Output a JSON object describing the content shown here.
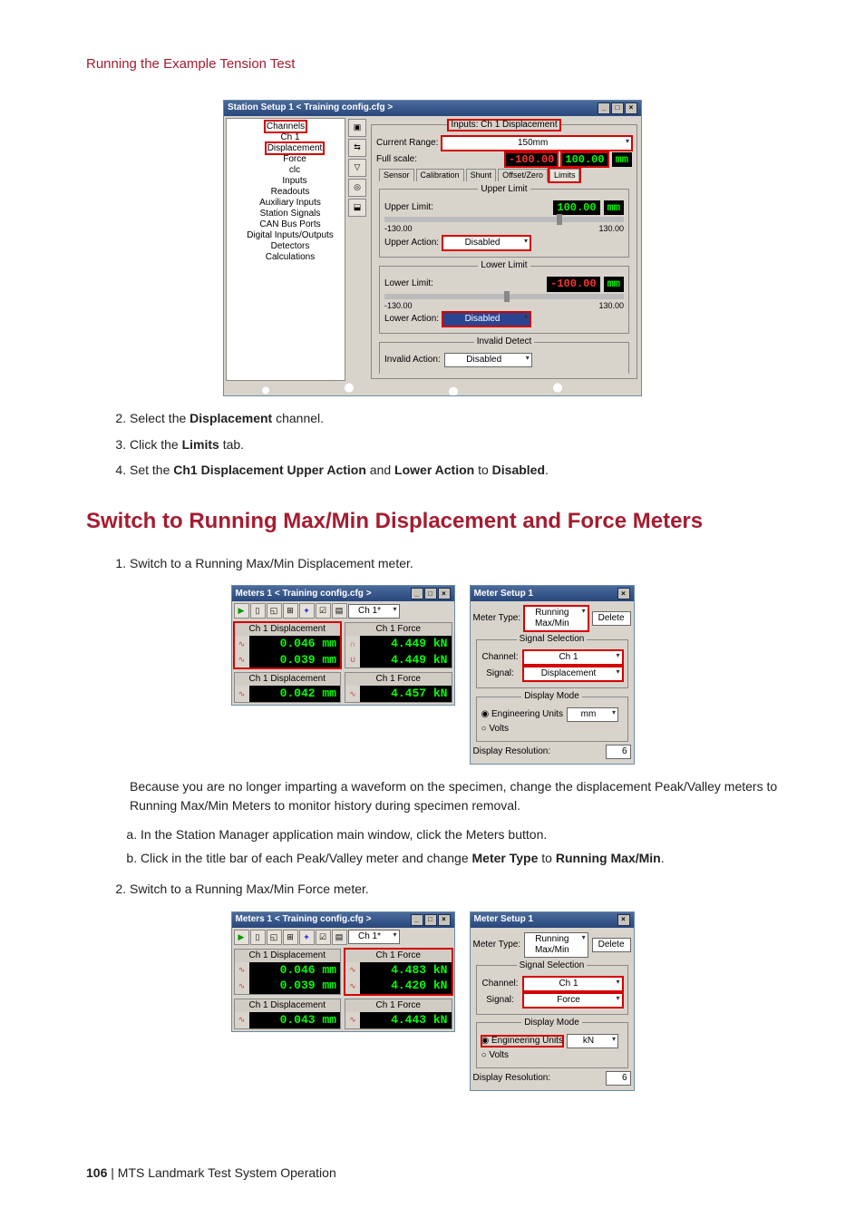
{
  "running_header": "Running the Example Tension Test",
  "steps_a": {
    "s2": {
      "pre": "Select the ",
      "bold": "Displacement",
      "post": " channel."
    },
    "s3": {
      "pre": "Click the ",
      "bold": "Limits",
      "post": " tab."
    },
    "s4": {
      "pre": "Set the ",
      "b1": "Ch1 Displacement Upper Action",
      "mid": " and ",
      "b2": "Lower Action",
      "post2": " to ",
      "b3": "Disabled",
      "end": "."
    }
  },
  "section_heading": "Switch to Running Max/Min Displacement and Force Meters",
  "step_b1": "Switch to a Running Max/Min Displacement meter.",
  "para_because": "Because you are no longer imparting a waveform on the specimen, change the displacement Peak/Valley meters to Running Max/Min Meters to monitor history during specimen removal.",
  "sub_a": "In the Station Manager application main window, click the Meters button.",
  "sub_b": {
    "pre": "Click in the title bar of each Peak/Valley meter and change ",
    "b1": "Meter Type",
    "mid": " to ",
    "b2": "Running Max/Min",
    "end": "."
  },
  "step_b2": "Switch to a Running Max/Min Force meter.",
  "footer": {
    "page": "106",
    "sep": " | ",
    "title": "MTS Landmark Test System Operation"
  },
  "station_setup": {
    "title": "Station Setup 1 < Training config.cfg >",
    "tree": {
      "root": "Channels",
      "ch1": "Ch 1",
      "disp": "Displacement",
      "force": "Force",
      "clc": "clc",
      "inputs": "Inputs",
      "readouts": "Readouts",
      "aux": "Auxiliary Inputs",
      "sig": "Station Signals",
      "can": "CAN Bus Ports",
      "dio": "Digital Inputs/Outputs",
      "det": "Detectors",
      "calc": "Calculations"
    },
    "panel_title": "Inputs: Ch 1 Displacement",
    "current_range_label": "Current Range:",
    "current_range_value": "150mm",
    "full_scale_label": "Full scale:",
    "full_scale_neg": "-100.00",
    "full_scale_pos": "100.00",
    "full_scale_unit": "mm",
    "tabs": [
      "Sensor",
      "Calibration",
      "Shunt",
      "Offset/Zero",
      "Limits"
    ],
    "upper_legend": "Upper Limit",
    "upper_limit_label": "Upper Limit:",
    "upper_limit_value": "100.00",
    "upper_limit_unit": "mm",
    "scale_min": "-130.00",
    "scale_max": "130.00",
    "upper_action_label": "Upper Action:",
    "upper_action_value": "Disabled",
    "lower_legend": "Lower Limit",
    "lower_limit_label": "Lower Limit:",
    "lower_limit_value": "-100.00",
    "lower_limit_unit": "mm",
    "lower_action_label": "Lower Action:",
    "lower_action_value": "Disabled",
    "invalid_legend": "Invalid Detect",
    "invalid_label": "Invalid Action:",
    "invalid_value": "Disabled"
  },
  "meters1": {
    "title": "Meters 1 < Training config.cfg >",
    "ch_combo": "Ch 1*",
    "disp_title": "Ch 1 Displacement",
    "force_title": "Ch 1 Force",
    "disp_r1": "0.046 mm",
    "disp_r2": "0.039 mm",
    "force_r1a": "4.449 kN",
    "force_r2a": "4.449 kN",
    "disp_single": "0.042 mm",
    "force_single": "4.457 kN"
  },
  "meter_setup1": {
    "title": "Meter Setup 1",
    "type_label": "Meter Type:",
    "type_value": "Running Max/Min",
    "delete": "Delete",
    "sig_legend": "Signal Selection",
    "channel_label": "Channel:",
    "channel_value": "Ch 1",
    "signal_label": "Signal:",
    "signal_value": "Displacement",
    "mode_legend": "Display Mode",
    "eng_units": "Engineering Units",
    "eng_units_val": "mm",
    "volts": "Volts",
    "res_label": "Display Resolution:",
    "res_value": "6"
  },
  "meters2": {
    "title": "Meters 1 < Training config.cfg >",
    "ch_combo": "Ch 1*",
    "disp_title": "Ch 1 Displacement",
    "force_title": "Ch 1 Force",
    "disp_r1": "0.046 mm",
    "disp_r2": "0.039 mm",
    "force_r1b": "4.483 kN",
    "force_r2b": "4.420 kN",
    "disp_single": "0.043 mm",
    "force_single": "4.443 kN"
  },
  "meter_setup2": {
    "title": "Meter Setup 1",
    "type_label": "Meter Type:",
    "type_value": "Running Max/Min",
    "delete": "Delete",
    "sig_legend": "Signal Selection",
    "channel_label": "Channel:",
    "channel_value": "Ch 1",
    "signal_label": "Signal:",
    "signal_value": "Force",
    "mode_legend": "Display Mode",
    "eng_units": "Engineering Units",
    "eng_units_val": "kN",
    "volts": "Volts",
    "res_label": "Display Resolution:",
    "res_value": "6"
  }
}
